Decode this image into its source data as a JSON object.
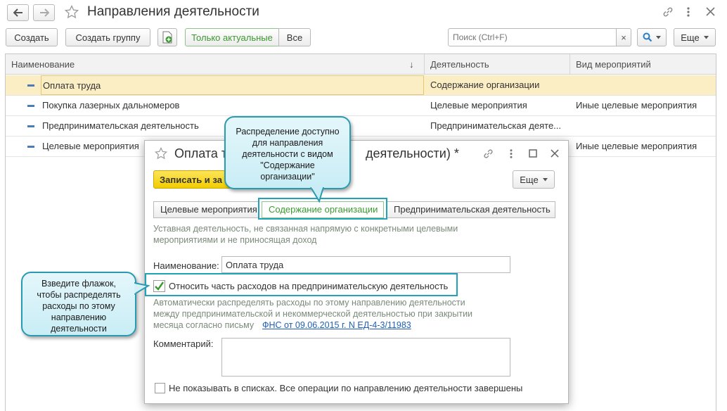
{
  "window": {
    "title": "Направления деятельности"
  },
  "toolbar": {
    "create": "Создать",
    "create_group": "Создать группу",
    "only_actual": "Только актуальные",
    "all": "Все",
    "search_placeholder": "Поиск (Ctrl+F)",
    "clear": "×",
    "more": "Еще"
  },
  "table": {
    "headers": {
      "name": "Наименование",
      "activity": "Деятельность",
      "event_type": "Вид мероприятий"
    },
    "sort_indicator": "↓",
    "rows": [
      {
        "name": "Оплата труда",
        "activity": "Содержание организации",
        "event_type": ""
      },
      {
        "name": "Покупка лазерных дальномеров",
        "activity": "Целевые мероприятия",
        "event_type": "Иные целевые мероприятия"
      },
      {
        "name": "Предпринимательская деятельность",
        "activity": "Предпринимательская деяте...",
        "event_type": ""
      },
      {
        "name": "Целевые мероприятия",
        "activity": "",
        "event_type": "Иные целевые мероприятия"
      }
    ]
  },
  "modal": {
    "title": "Оплата т",
    "title_suffix": "деятельности) *",
    "save_close": "Записать и за",
    "more": "Еще",
    "tabs": [
      "Целевые мероприятия",
      "Содержание организации",
      "Предпринимательская деятельность"
    ],
    "active_tab": 1,
    "tab_description": "Уставная деятельность, не связанная напрямую с конкретными целевыми мероприятиями и не приносящая доход",
    "name_label": "Наименование:",
    "name_value": "Оплата труда",
    "checkbox_label": "Относить часть расходов на предпринимательскую деятельность",
    "checkbox_checked": true,
    "hint_line1": "Автоматически распределять расходы по этому направлению деятельности",
    "hint_line2": "между предпринимательской и некоммерческой деятельностью при закрытии",
    "hint_line3": "месяца согласно письму",
    "hint_link": "ФНС от 09.06.2015 г. N ЕД-4-3/11983",
    "comment_label": "Комментарий:",
    "comment_value": "",
    "hide_label": "Не показывать в списках. Все операции по направлению деятельности завершены",
    "hide_checked": false
  },
  "callouts": {
    "top": "Распределение доступно для направления деятельности с видом \"Содержание организации\"",
    "left": "Взведите флажок, чтобы распределять расходы по этому направлению деятельности"
  },
  "colors": {
    "accent_green": "#3a9a2f",
    "callout_border": "#2a9ab0",
    "selected_row": "#fbeec4",
    "save_button": "#f5d20c"
  }
}
